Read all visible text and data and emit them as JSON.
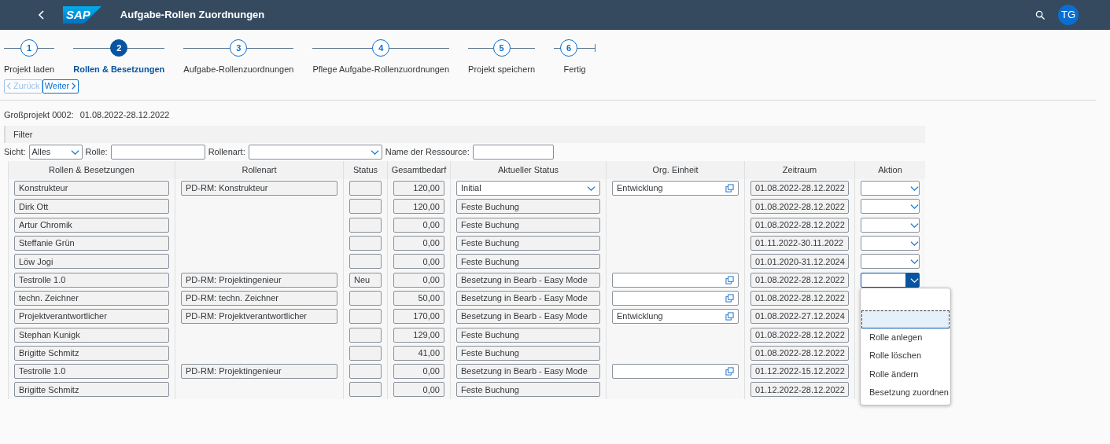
{
  "shell": {
    "logo": "SAP",
    "title": "Aufgabe-Rollen Zuordnungen",
    "avatar": "TG"
  },
  "wizard": {
    "steps": [
      {
        "number": "1",
        "label": "Projekt laden",
        "selected": false
      },
      {
        "number": "2",
        "label": "Rollen & Besetzungen",
        "selected": true
      },
      {
        "number": "3",
        "label": "Aufgabe-Rollenzuordnungen",
        "selected": false
      },
      {
        "number": "4",
        "label": "Pflege Aufgabe-Rollenzuordnungen",
        "selected": false
      },
      {
        "number": "5",
        "label": "Projekt speichern",
        "selected": false
      },
      {
        "number": "6",
        "label": "Fertig",
        "selected": false
      }
    ],
    "buttons": [
      {
        "kind": "back",
        "label": "Zurück",
        "disabled": true
      },
      {
        "kind": "next",
        "label": "Weiter",
        "disabled": false
      }
    ]
  },
  "project": {
    "label": "Großprojekt 0002:",
    "value": "01.08.2022-28.12.2022"
  },
  "filter": {
    "title": "Filter",
    "fields": [
      {
        "kind": "select",
        "label": "Sicht:",
        "value": "Alles"
      },
      {
        "kind": "text",
        "label": "Rolle:"
      },
      {
        "kind": "select",
        "label": "Rollenart:"
      },
      {
        "kind": "text",
        "label": "Name der Ressource:"
      }
    ]
  },
  "table": {
    "columns": [
      "Rollen & Besetzungen",
      "Rollenart",
      "Status",
      "Gesamtbedarf",
      "Aktueller Status",
      "Org. Einheit",
      "Zeitraum",
      "Aktion"
    ],
    "rows": [
      {
        "role": "Konstrukteur",
        "role_type": "PD-RM: Konstrukteur",
        "demand": "120,00",
        "current_status": {
          "kind": "dropdown",
          "text": "Initial"
        },
        "org_field": true,
        "org_unit": "Entwicklung",
        "period": "01.08.2022-28.12.2022",
        "action_open": false
      },
      {
        "role": "Dirk Ott",
        "demand": "120,00",
        "current_status": {
          "kind": "readonly",
          "text": "Feste Buchung"
        },
        "org_field": false,
        "period": "01.08.2022-28.12.2022",
        "action_open": false
      },
      {
        "role": "Artur Chromik",
        "demand": "0,00",
        "current_status": {
          "kind": "readonly",
          "text": "Feste Buchung"
        },
        "org_field": false,
        "period": "01.08.2022-28.12.2022",
        "action_open": false
      },
      {
        "role": "Steffanie Grün",
        "demand": "0,00",
        "current_status": {
          "kind": "readonly",
          "text": "Feste Buchung"
        },
        "org_field": false,
        "period": "01.11.2022-30.11.2022",
        "action_open": false
      },
      {
        "role": "Löw Jogi",
        "demand": "0,00",
        "current_status": {
          "kind": "readonly",
          "text": "Feste Buchung"
        },
        "org_field": false,
        "period": "01.01.2020-31.12.2024",
        "action_open": false
      },
      {
        "role": "Testrolle 1.0",
        "role_type": "PD-RM: Projektingenieur",
        "status": "Neu",
        "demand": "0,00",
        "current_status": {
          "kind": "readonly",
          "text": "Besetzung in Bearb - Easy Mode"
        },
        "org_field": true,
        "period": "01.08.2022-28.12.2022",
        "action_open": true
      },
      {
        "role": "techn. Zeichner",
        "role_type": "PD-RM: techn. Zeichner",
        "demand": "50,00",
        "current_status": {
          "kind": "readonly",
          "text": "Besetzung in Bearb - Easy Mode"
        },
        "org_field": true,
        "period": "01.08.2022-28.12.2022"
      },
      {
        "role": "Projektverantwortlicher",
        "role_type": "PD-RM: Projektverantwortlicher",
        "demand": "170,00",
        "current_status": {
          "kind": "readonly",
          "text": "Besetzung in Bearb - Easy Mode"
        },
        "org_field": true,
        "org_unit": "Entwicklung",
        "period": "01.08.2022-27.12.2024"
      },
      {
        "role": "Stephan Kunigk",
        "demand": "129,00",
        "current_status": {
          "kind": "readonly",
          "text": "Feste Buchung"
        },
        "org_field": false,
        "period": "01.08.2022-28.12.2022"
      },
      {
        "role": "Brigitte Schmitz",
        "demand": "41,00",
        "current_status": {
          "kind": "readonly",
          "text": "Feste Buchung"
        },
        "org_field": false,
        "period": "01.08.2022-28.12.2022"
      },
      {
        "role": "Testrolle 1.0",
        "role_type": "PD-RM: Projektingenieur",
        "demand": "0,00",
        "current_status": {
          "kind": "readonly",
          "text": "Besetzung in Bearb - Easy Mode"
        },
        "org_field": true,
        "period": "01.12.2022-15.12.2022"
      },
      {
        "role": "Brigitte Schmitz",
        "demand": "0,00",
        "current_status": {
          "kind": "readonly",
          "text": "Feste Buchung"
        },
        "org_field": false,
        "period": "01.12.2022-28.12.2022"
      }
    ]
  },
  "action_menu": {
    "entries": [
      {
        "kind": "blank",
        "selected": false
      },
      {
        "kind": "blank",
        "selected": true
      },
      {
        "kind": "option",
        "label": "Rolle anlegen",
        "selected": false
      },
      {
        "kind": "option",
        "label": "Rolle löschen",
        "selected": false
      },
      {
        "kind": "option",
        "label": "Rolle ändern",
        "selected": false
      },
      {
        "kind": "option",
        "label": "Besetzung zuordnen",
        "selected": false
      }
    ]
  }
}
